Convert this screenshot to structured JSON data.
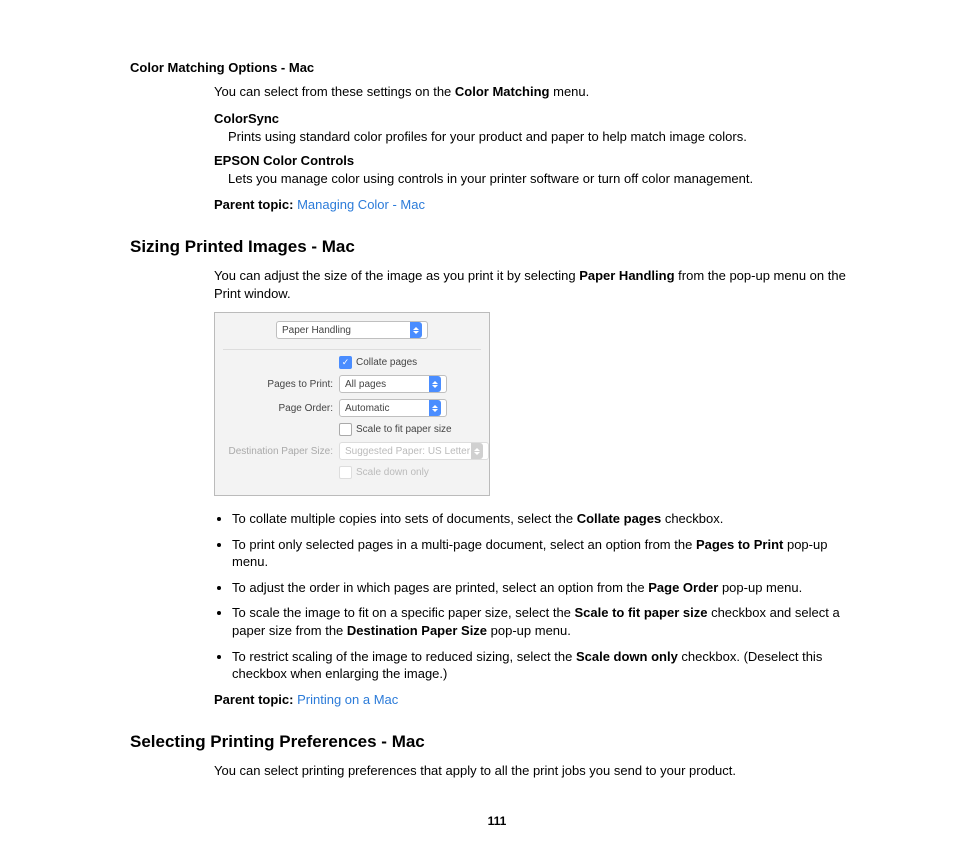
{
  "section1_title": "Color Matching Options - Mac",
  "section1_intro_a": "You can select from these settings on the ",
  "section1_intro_bold": "Color Matching",
  "section1_intro_b": " menu.",
  "def1_term": "ColorSync",
  "def1_desc": "Prints using standard color profiles for your product and paper to help match image colors.",
  "def2_term": "EPSON Color Controls",
  "def2_desc": "Lets you manage color using controls in your printer software or turn off color management.",
  "parent_label": "Parent topic:",
  "parent1_link": "Managing Color - Mac",
  "h2_sizing": "Sizing Printed Images - Mac",
  "sizing_intro_a": "You can adjust the size of the image as you print it by selecting ",
  "sizing_intro_bold": "Paper Handling",
  "sizing_intro_b": " from the pop-up menu on the Print window.",
  "dialog": {
    "top_select": "Paper Handling",
    "collate_label": "Collate pages",
    "pages_label": "Pages to Print:",
    "pages_value": "All pages",
    "order_label": "Page Order:",
    "order_value": "Automatic",
    "scale_fit_label": "Scale to fit paper size",
    "dest_label": "Destination Paper Size:",
    "dest_value": "Suggested Paper: US Letter",
    "scale_down_label": "Scale down only"
  },
  "b1_a": "To collate multiple copies into sets of documents, select the ",
  "b1_bold": "Collate pages",
  "b1_b": " checkbox.",
  "b2_a": "To print only selected pages in a multi-page document, select an option from the ",
  "b2_bold": "Pages to Print",
  "b2_b": " pop-up menu.",
  "b3_a": "To adjust the order in which pages are printed, select an option from the ",
  "b3_bold": "Page Order",
  "b3_b": " pop-up menu.",
  "b4_a": "To scale the image to fit on a specific paper size, select the ",
  "b4_bold1": "Scale to fit paper size",
  "b4_b": " checkbox and select a paper size from the ",
  "b4_bold2": "Destination Paper Size",
  "b4_c": " pop-up menu.",
  "b5_a": "To restrict scaling of the image to reduced sizing, select the ",
  "b5_bold": "Scale down only",
  "b5_b": " checkbox. (Deselect this checkbox when enlarging the image.)",
  "parent2_link": "Printing on a Mac",
  "h2_prefs": "Selecting Printing Preferences - Mac",
  "prefs_intro": "You can select printing preferences that apply to all the print jobs you send to your product.",
  "page_number": "111"
}
